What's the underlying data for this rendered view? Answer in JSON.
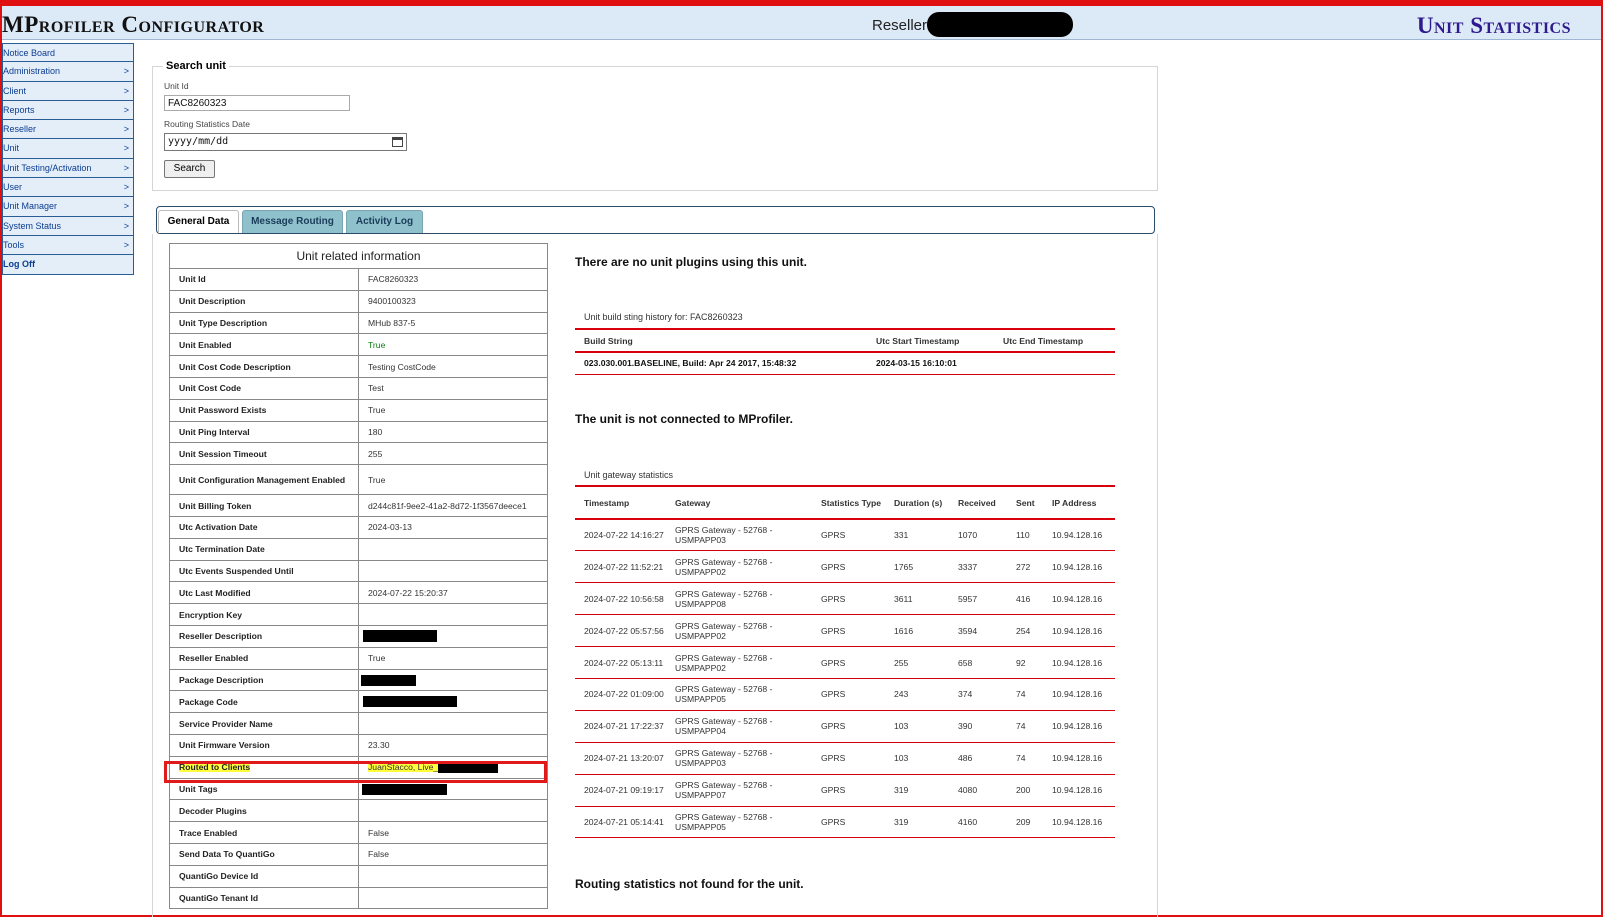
{
  "header": {
    "app_title": "MProfiler Configurator",
    "reseller_label": "Reseller",
    "page_title": "Unit Statistics"
  },
  "sidebar": {
    "items": [
      {
        "label": "Notice Board",
        "chevron": ""
      },
      {
        "label": "Administration",
        "chevron": ">"
      },
      {
        "label": "Client",
        "chevron": ">"
      },
      {
        "label": "Reports",
        "chevron": ">"
      },
      {
        "label": "Reseller",
        "chevron": ">"
      },
      {
        "label": "Unit",
        "chevron": ">"
      },
      {
        "label": "Unit Testing/Activation",
        "chevron": ">"
      },
      {
        "label": "User",
        "chevron": ">"
      },
      {
        "label": "Unit Manager",
        "chevron": ">"
      },
      {
        "label": "System Status",
        "chevron": ">"
      },
      {
        "label": "Tools",
        "chevron": ">"
      },
      {
        "label": "Log Off",
        "chevron": ""
      }
    ]
  },
  "search": {
    "legend": "Search unit",
    "unit_id_label": "Unit Id",
    "unit_id_value": "FAC8260323",
    "date_label": "Routing Statistics Date",
    "date_placeholder": "yyyy/mm/dd",
    "search_button": "Search"
  },
  "tabs": [
    "General Data",
    "Message Routing",
    "Activity Log"
  ],
  "unit_info": {
    "title": "Unit related information",
    "rows": [
      {
        "key": "Unit Id",
        "value": "FAC8260323"
      },
      {
        "key": "Unit Description",
        "value": "9400100323"
      },
      {
        "key": "Unit Type Description",
        "value": "MHub 837-5"
      },
      {
        "key": "Unit Enabled",
        "value": "True"
      },
      {
        "key": "Unit Cost Code Description",
        "value": "Testing CostCode"
      },
      {
        "key": "Unit Cost Code",
        "value": "Test"
      },
      {
        "key": "Unit Password Exists",
        "value": "True"
      },
      {
        "key": "Unit Ping Interval",
        "value": "180"
      },
      {
        "key": "Unit Session Timeout",
        "value": "255"
      },
      {
        "key": "Unit Configuration Management Enabled",
        "value": "True"
      },
      {
        "key": "Unit Billing Token",
        "value": "d244c81f-9ee2-41a2-8d72-1f3567deece1"
      },
      {
        "key": "Utc Activation Date",
        "value": "2024-03-13"
      },
      {
        "key": "Utc Termination Date",
        "value": ""
      },
      {
        "key": "Utc Events Suspended Until",
        "value": ""
      },
      {
        "key": "Utc Last Modified",
        "value": "2024-07-22 15:20:37"
      },
      {
        "key": "Encryption Key",
        "value": ""
      },
      {
        "key": "Reseller Description",
        "value": ""
      },
      {
        "key": "Reseller Enabled",
        "value": "True"
      },
      {
        "key": "Package Description",
        "value": ""
      },
      {
        "key": "Package Code",
        "value": ""
      },
      {
        "key": "Service Provider Name",
        "value": ""
      },
      {
        "key": "Unit Firmware Version",
        "value": "23.30"
      },
      {
        "key": "Routed to Clients",
        "value": "JuanStacco, Live_"
      },
      {
        "key": "Unit Tags",
        "value": ""
      },
      {
        "key": "Decoder Plugins",
        "value": ""
      },
      {
        "key": "Trace Enabled",
        "value": "False"
      },
      {
        "key": "Send Data To QuantiGo",
        "value": "False"
      },
      {
        "key": "QuantiGo Device Id",
        "value": ""
      },
      {
        "key": "QuantiGo Tenant Id",
        "value": ""
      }
    ]
  },
  "messages": {
    "no_plugins": "There are no unit plugins using this unit.",
    "not_connected": "The unit is not connected to MProfiler.",
    "no_routing": "Routing statistics not found for the unit."
  },
  "build_history": {
    "title": "Unit build sting history for: FAC8260323",
    "headers": [
      "Build String",
      "Utc Start Timestamp",
      "Utc End Timestamp"
    ],
    "rows": [
      [
        "023.030.001.BASELINE, Build: Apr 24 2017, 15:48:32",
        "2024-03-15 16:10:01",
        ""
      ]
    ]
  },
  "gateway_stats": {
    "title": "Unit gateway statistics",
    "headers": [
      "Timestamp",
      "Gateway",
      "Statistics Type",
      "Duration (s)",
      "Received",
      "Sent",
      "IP Address"
    ],
    "rows": [
      [
        "2024-07-22 14:16:27",
        "GPRS Gateway - 52768 - USMPAPP03",
        "GPRS",
        "331",
        "1070",
        "110",
        "10.94.128.16"
      ],
      [
        "2024-07-22 11:52:21",
        "GPRS Gateway - 52768 - USMPAPP02",
        "GPRS",
        "1765",
        "3337",
        "272",
        "10.94.128.16"
      ],
      [
        "2024-07-22 10:56:58",
        "GPRS Gateway - 52768 - USMPAPP08",
        "GPRS",
        "3611",
        "5957",
        "416",
        "10.94.128.16"
      ],
      [
        "2024-07-22 05:57:56",
        "GPRS Gateway - 52768 - USMPAPP02",
        "GPRS",
        "1616",
        "3594",
        "254",
        "10.94.128.16"
      ],
      [
        "2024-07-22 05:13:11",
        "GPRS Gateway - 52768 - USMPAPP02",
        "GPRS",
        "255",
        "658",
        "92",
        "10.94.128.16"
      ],
      [
        "2024-07-22 01:09:00",
        "GPRS Gateway - 52768 - USMPAPP05",
        "GPRS",
        "243",
        "374",
        "74",
        "10.94.128.16"
      ],
      [
        "2024-07-21 17:22:37",
        "GPRS Gateway - 52768 - USMPAPP04",
        "GPRS",
        "103",
        "390",
        "74",
        "10.94.128.16"
      ],
      [
        "2024-07-21 13:20:07",
        "GPRS Gateway - 52768 - USMPAPP03",
        "GPRS",
        "103",
        "486",
        "74",
        "10.94.128.16"
      ],
      [
        "2024-07-21 09:19:17",
        "GPRS Gateway - 52768 - USMPAPP07",
        "GPRS",
        "319",
        "4080",
        "200",
        "10.94.128.16"
      ],
      [
        "2024-07-21 05:14:41",
        "GPRS Gateway - 52768 - USMPAPP05",
        "GPRS",
        "319",
        "4160",
        "209",
        "10.94.128.16"
      ]
    ]
  },
  "colors": {
    "accent_red": "#d9000d",
    "title_purple": "#2e1a8e",
    "highlight_yellow": "#ffff3b",
    "enabled_green": "#0a7d12"
  }
}
